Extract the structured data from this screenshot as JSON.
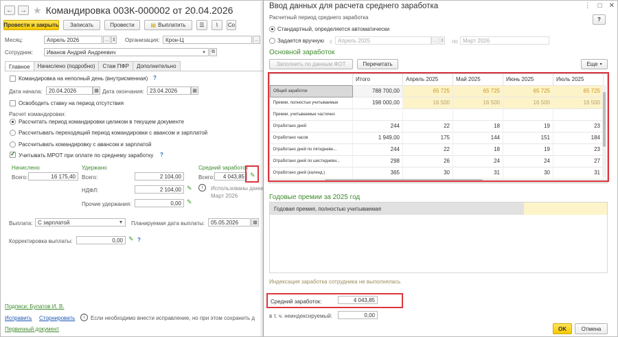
{
  "left": {
    "title": "Командировка 003К-000002 от 20.04.2026",
    "toolbar": {
      "post_close": "Провести и закрыть",
      "save": "Записать",
      "post": "Провести",
      "pay": "Выплатить",
      "more": "Co"
    },
    "month_label": "Месяц:",
    "month_value": "Апрель 2026",
    "org_label": "Организация:",
    "org_value": "Крон-Ц",
    "employee_label": "Сотрудник:",
    "employee_value": "Иванов Андрей Андреевич",
    "tabs": [
      "Главное",
      "Начислено (подробно)",
      "Стаж ПФР",
      "Дополнительно"
    ],
    "part_day": "Командировка на неполный день (внутрисменная)",
    "start_label": "Дата начала:",
    "start_value": "20.04.2026",
    "end_label": "Дата окончания:",
    "end_value": "23.04.2026",
    "free_rate": "Освободить ставку на период отсутствия",
    "calc_title": "Расчет командировки:",
    "calc_opt1": "Рассчитать период командировки целиком в текущем документе",
    "calc_opt2": "Рассчитывать переходящий период командировки с авансом и зарплатой",
    "calc_opt3": "Рассчитывать командировку с авансом и зарплатой",
    "mrot": "Учитывать МРОТ при оплате по среднему заработку",
    "accrued_title": "Начислено",
    "withheld_title": "Удержано",
    "avg_title": "Средний заработок",
    "total_label": "Всего:",
    "accrued_total": "16 175,40",
    "withheld_total": "2 104,00",
    "avg_value": "4 043,85",
    "ndfl_label": "НДФЛ:",
    "ndfl_value": "2 104,00",
    "other_label": "Прочие удержания:",
    "other_value": "0,00",
    "used_data": "Использованы данные",
    "used_period": "Март 2026",
    "payout_label": "Выплата:",
    "payout_value": "С зарплатой",
    "plan_date_label": "Планируемая дата выплаты:",
    "plan_date_value": "05.05.2026",
    "adjust_label": "Корректировка выплаты:",
    "adjust_value": "0,00",
    "signatures": "Подписи: Булатов И. В.",
    "fix": "Исправить",
    "storno": "Сторнировать",
    "fix_hint": "Если необходимо внести исправление, но при этом сохранить д",
    "primary_doc": "Первичный документ"
  },
  "dialog": {
    "title": "Ввод данных для расчета среднего заработка",
    "period_label": "Расчетный период среднего заработка",
    "opt_standard": "Стандартный, определяется автоматически",
    "opt_manual": "Задается вручную",
    "from_label": "с",
    "from_value": "Апрель 2025",
    "to_label": "по",
    "to_value": "Март 2026",
    "main_section": "Основной заработок",
    "fill_fot": "Заполнить по данным ФОТ",
    "refill": "Перечитать",
    "more": "Еще",
    "columns": [
      "",
      "Итого",
      "Апрель 2025",
      "Май 2025",
      "Июнь 2025",
      "Июль 2025"
    ],
    "rows": [
      {
        "name": "Общий заработок",
        "total": "788 700,00",
        "m": [
          "65 725",
          "65 725",
          "65 725",
          "65 725"
        ]
      },
      {
        "name": "Премии, полностью учитываемые",
        "total": "198 000,00",
        "m": [
          "16 500",
          "16 500",
          "16 500",
          "16 500"
        ]
      },
      {
        "name": "Премии, учитываемые частично",
        "total": "",
        "m": [
          "",
          "",
          "",
          ""
        ]
      },
      {
        "name": "Отработано дней",
        "total": "244",
        "m": [
          "22",
          "18",
          "19",
          "23"
        ]
      },
      {
        "name": "Отработано часов",
        "total": "1 949,00",
        "m": [
          "175",
          "144",
          "151",
          "184"
        ]
      },
      {
        "name": "Отработано дней по пятидневн...",
        "total": "244",
        "m": [
          "22",
          "18",
          "19",
          "23"
        ]
      },
      {
        "name": "Отработано дней по шестидневн...",
        "total": "298",
        "m": [
          "26",
          "24",
          "24",
          "27"
        ]
      },
      {
        "name": "Отработано дней (календ.)",
        "total": "365",
        "m": [
          "30",
          "31",
          "30",
          "31"
        ]
      }
    ],
    "bonus_section": "Годовые премии за 2025 год",
    "bonus_row": "Годовая премия, полностью учитываемая",
    "indexation_note": "Индексация заработка сотрудника не выполнялась",
    "avg_label": "Средний заработок:",
    "avg_value": "4 043,85",
    "nonindex_label": "в т. ч. неиндексируемый:",
    "nonindex_value": "0,00",
    "ok": "OK",
    "cancel": "Отмена"
  },
  "colors": {
    "accent_yellow": "#f5c800",
    "section_green": "#3d8a2a",
    "highlight_red": "#d9363e"
  }
}
